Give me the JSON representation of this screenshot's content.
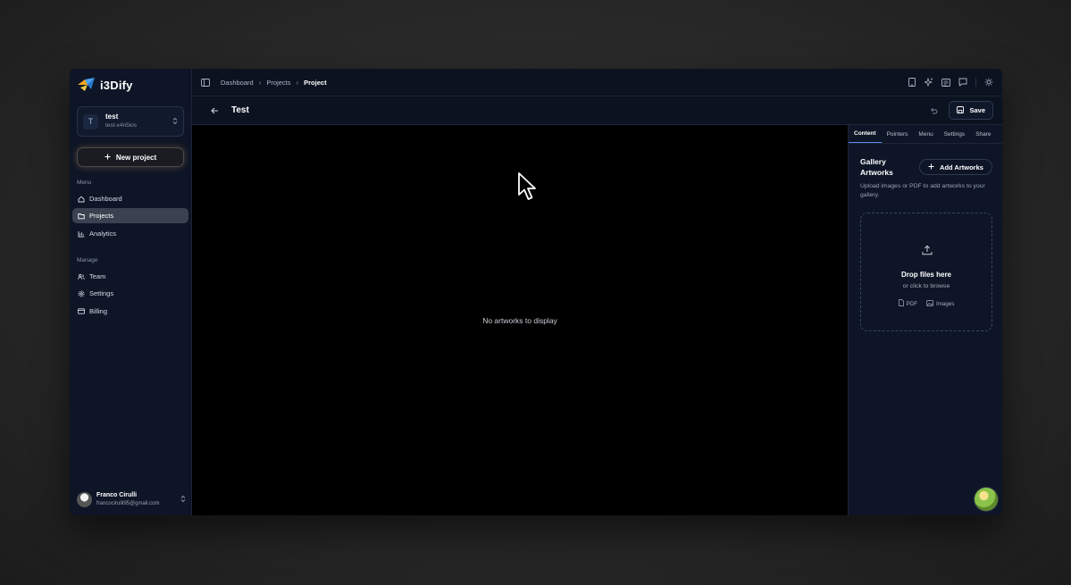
{
  "app": {
    "name": "i3Dify"
  },
  "workspace": {
    "initial": "T",
    "name": "test",
    "slug": "test-x4n5ios"
  },
  "sidebar": {
    "new_project_label": "New project",
    "menu_label": "Menu",
    "menu_items": [
      "Dashboard",
      "Projects",
      "Analytics"
    ],
    "active_item": "Projects",
    "manage_label": "Manage",
    "manage_items": [
      "Team",
      "Settings",
      "Billing"
    ]
  },
  "user": {
    "name": "Franco Cirulli",
    "email": "francocirulli95@gmail.com"
  },
  "breadcrumb": {
    "items": [
      "Dashboard",
      "Projects"
    ],
    "current": "Project"
  },
  "project": {
    "title": "Test",
    "save_label": "Save"
  },
  "canvas": {
    "empty_text": "No artworks to display"
  },
  "panel": {
    "tabs": [
      "Content",
      "Pointers",
      "Menu",
      "Settings",
      "Share"
    ],
    "active_tab": "Content",
    "gallery_title": "Gallery Artworks",
    "add_button": "Add Artworks",
    "description": "Upload images or PDF to add artworks to your gallery.",
    "dropzone": {
      "title": "Drop files here",
      "subtitle": "or click to browse",
      "types": [
        "PDF",
        "Images"
      ]
    }
  },
  "colors": {
    "accent": "#5b8def",
    "canvas_bg": "#000000",
    "window_bg": "#0b1220"
  }
}
